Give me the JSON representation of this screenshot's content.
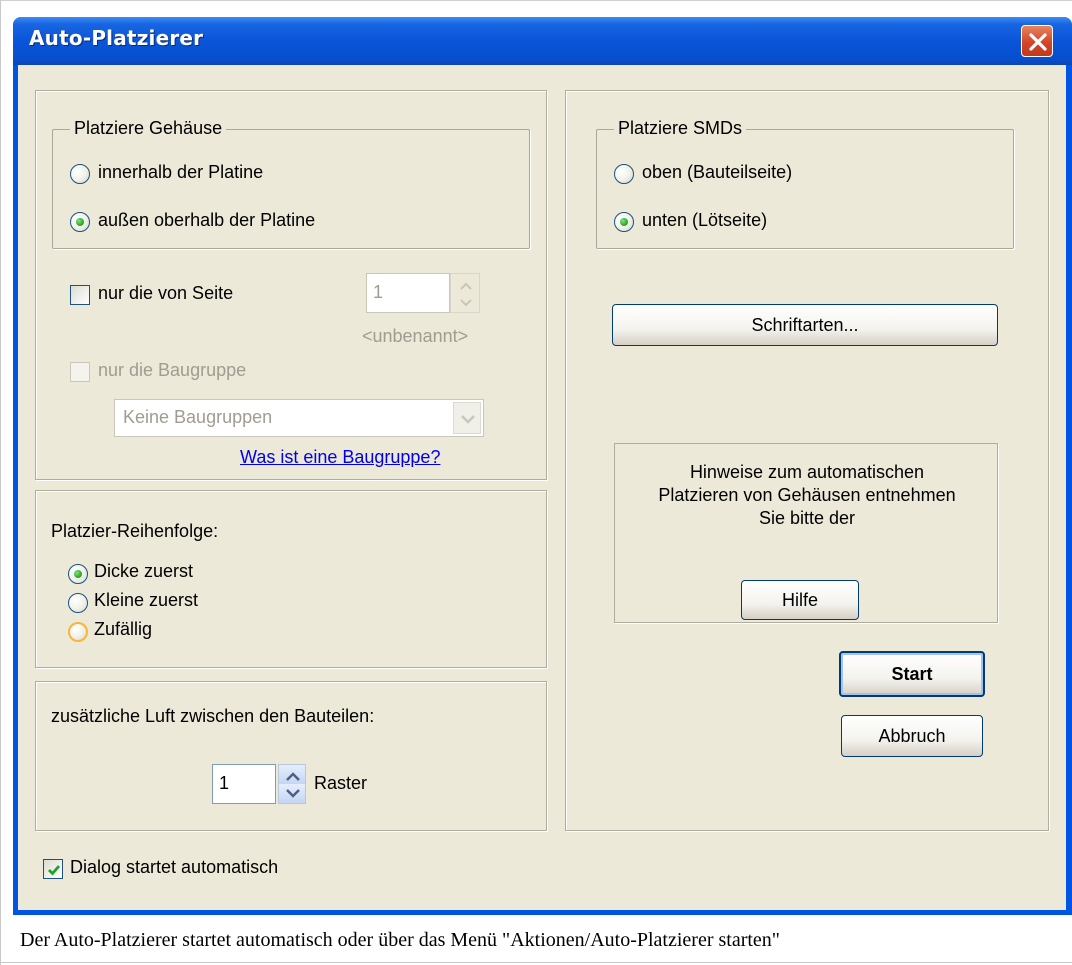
{
  "window": {
    "title": "Auto-Platzierer"
  },
  "left": {
    "placement_group": {
      "legend": "Platziere Gehäuse",
      "options": [
        {
          "label": "innerhalb der Platine",
          "checked": false
        },
        {
          "label": "außen oberhalb der Platine",
          "checked": true
        }
      ]
    },
    "page_only": {
      "label": "nur die von Seite",
      "checked": false,
      "spin_value": "1",
      "page_name": "<unbenannt>"
    },
    "assembly_only": {
      "label": "nur die Baugruppe",
      "checked": false,
      "disabled": true,
      "select_value": "Keine Baugruppen"
    },
    "assembly_link": "Was ist eine Baugruppe?",
    "order": {
      "title": "Platzier-Reihenfolge:",
      "options": [
        {
          "label": "Dicke zuerst",
          "checked": true
        },
        {
          "label": "Kleine zuerst",
          "checked": false
        },
        {
          "label": "Zufällig",
          "checked": false
        }
      ]
    },
    "spacing": {
      "label": "zusätzliche Luft zwischen den Bauteilen:",
      "value": "1",
      "unit": "Raster"
    }
  },
  "right": {
    "smd_group": {
      "legend": "Platziere SMDs",
      "options": [
        {
          "label": "oben (Bauteilseite)",
          "checked": false
        },
        {
          "label": "unten (Lötseite)",
          "checked": true
        }
      ]
    },
    "fonts_button": "Schriftarten...",
    "hint": {
      "line1": "Hinweise zum automatischen",
      "line2": "Platzieren von Gehäusen entnehmen",
      "line3": "Sie bitte der",
      "help_button": "Hilfe"
    },
    "start_button": "Start",
    "cancel_button": "Abbruch"
  },
  "auto_start": {
    "label": "Dialog startet automatisch",
    "checked": true
  },
  "caption": "Der Auto-Platzierer startet automatisch oder über das Menü \"Aktionen/Auto-Platzierer starten\"",
  "colors": {
    "titlebar": "#0a55d8",
    "dialog_bg": "#ece9d8",
    "radio_dot": "#21a121",
    "link": "#0000ee"
  }
}
